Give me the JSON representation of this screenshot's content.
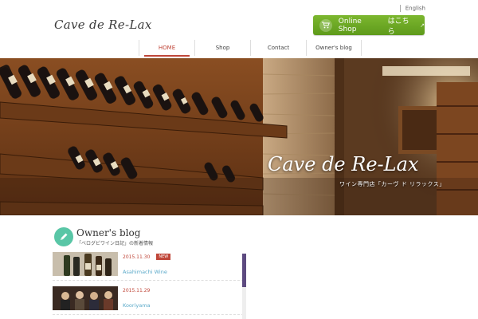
{
  "header": {
    "logo_text": "Cave de Re-Lax",
    "language_link": "English",
    "shop_button": {
      "label": "Online Shop",
      "label_jp": "はこちら",
      "icon": "cart-icon",
      "color": "#6aaa24"
    }
  },
  "nav": {
    "items": [
      {
        "label": "HOME",
        "active": true
      },
      {
        "label": "Shop",
        "active": false
      },
      {
        "label": "Contact",
        "active": false
      },
      {
        "label": "Owner's blog",
        "active": false
      }
    ],
    "accent": "#c0473a"
  },
  "hero": {
    "logo_text": "Cave de Re-Lax",
    "subtitle": "ワイン専門店「カーヴ ド リラックス」"
  },
  "blog": {
    "title": "Owner's blog",
    "subtitle": "「ベログビワイン日記」の新着情報",
    "icon": "pen-icon",
    "posts": [
      {
        "date": "2015.11.30",
        "badge": "NEW",
        "title": "Asahimachi Wine"
      },
      {
        "date": "2015.11.29",
        "badge": "",
        "title": "Kooriyama"
      }
    ]
  }
}
